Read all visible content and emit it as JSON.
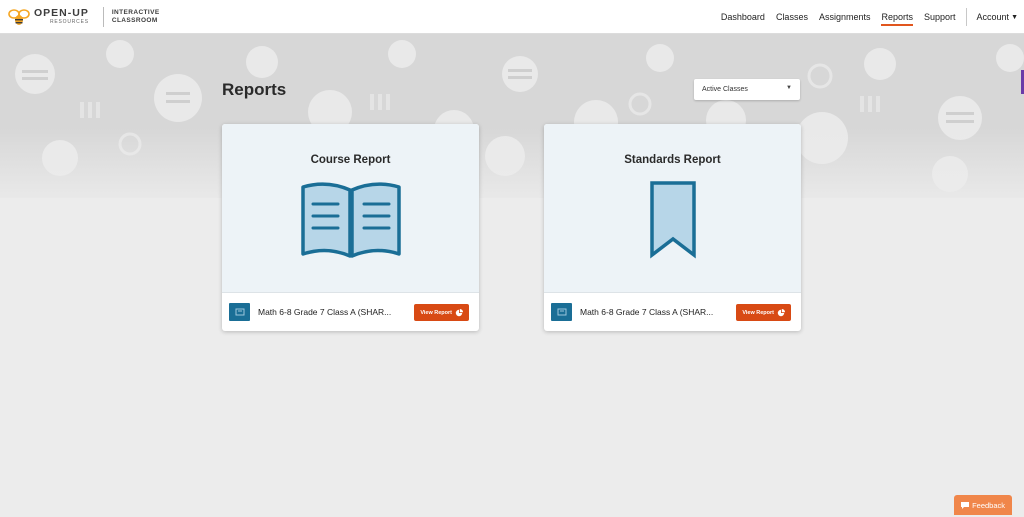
{
  "brand": {
    "name": "OPEN-UP",
    "sub": "RESOURCES",
    "product_line1": "INTERACTIVE",
    "product_line2": "CLASSROOM",
    "logo_icon": "bee-icon",
    "accent": "#f5a623"
  },
  "nav": {
    "items": [
      "Dashboard",
      "Classes",
      "Assignments",
      "Reports",
      "Support"
    ],
    "active": "Reports",
    "account": "Account"
  },
  "page": {
    "title": "Reports"
  },
  "filter": {
    "selected": "Active Classes"
  },
  "cards": [
    {
      "title": "Course Report",
      "icon": "open-book-icon",
      "class_name": "Math 6-8 Grade 7 Class A (SHAR...",
      "button": "View Report"
    },
    {
      "title": "Standards Report",
      "icon": "bookmark-icon",
      "class_name": "Math 6-8 Grade 7 Class A (SHAR...",
      "button": "View Report"
    }
  ],
  "feedback": {
    "label": "Feedback"
  },
  "colors": {
    "primary": "#1a6e96",
    "button": "#d84a14",
    "feedback": "#f0864a",
    "nav_active": "#e1561e",
    "card_bg": "#edf3f7",
    "icon_fill": "#b7d6e8"
  }
}
